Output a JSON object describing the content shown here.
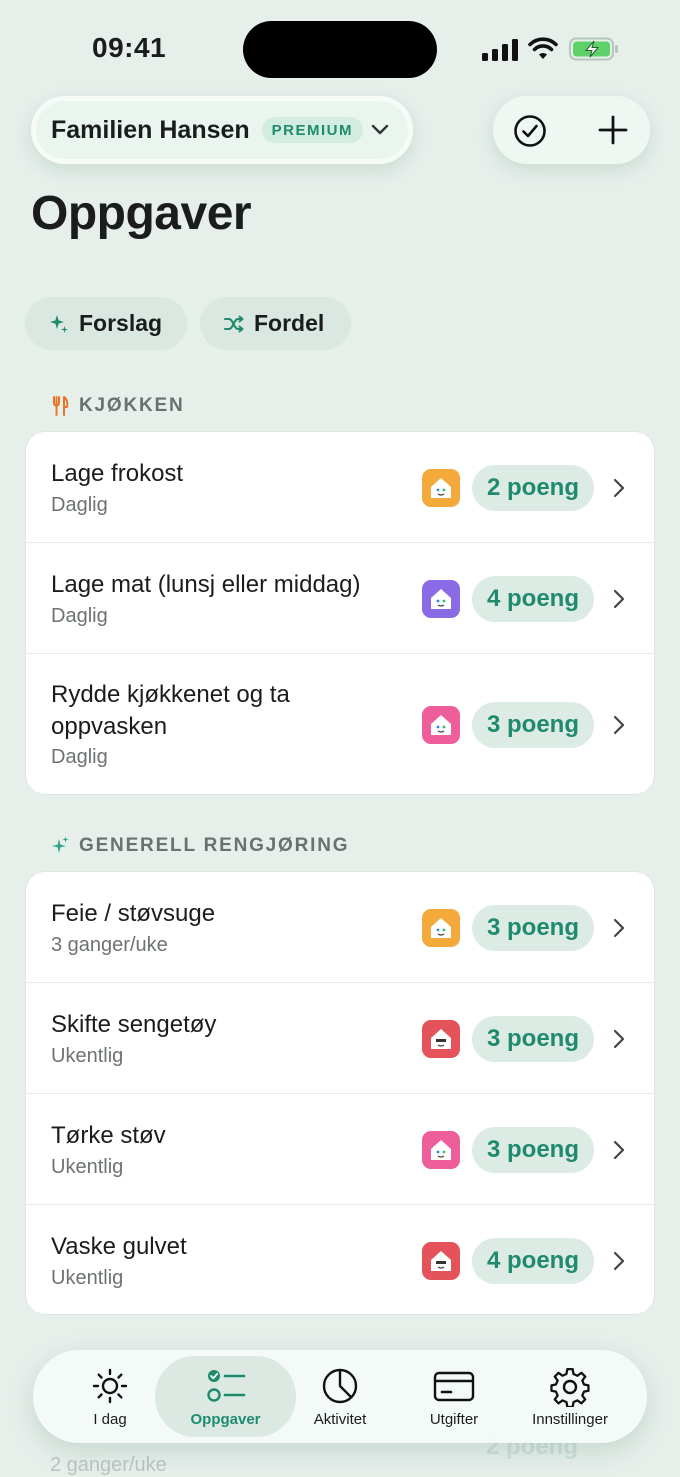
{
  "status_bar": {
    "time": "09:41"
  },
  "header": {
    "family_name": "Familien Hansen",
    "premium_label": "PREMIUM",
    "page_title": "Oppgaver"
  },
  "chips": {
    "forslag": "Forslag",
    "fordel": "Fordel"
  },
  "sections": [
    {
      "title": "KJØKKEN",
      "icon": "fork-knife-icon",
      "tasks": [
        {
          "title": "Lage frokost",
          "frequency": "Daglig",
          "points": "2 poeng",
          "avatar_color": "#f4a93b"
        },
        {
          "title": "Lage mat (lunsj eller middag)",
          "frequency": "Daglig",
          "points": "4 poeng",
          "avatar_color": "#8a6be6"
        },
        {
          "title": "Rydde kjøkkenet og ta oppvasken",
          "frequency": "Daglig",
          "points": "3 poeng",
          "avatar_color": "#ee5e9b"
        }
      ]
    },
    {
      "title": "GENERELL RENGJØRING",
      "icon": "sparkle-icon",
      "tasks": [
        {
          "title": "Feie / støvsuge",
          "frequency": "3 ganger/uke",
          "points": "3 poeng",
          "avatar_color": "#f4a93b"
        },
        {
          "title": "Skifte sengetøy",
          "frequency": "Ukentlig",
          "points": "3 poeng",
          "avatar_color": "#e4525a"
        },
        {
          "title": "Tørke støv",
          "frequency": "Ukentlig",
          "points": "3 poeng",
          "avatar_color": "#ee5e9b"
        },
        {
          "title": "Vaske gulvet",
          "frequency": "Ukentlig",
          "points": "4 poeng",
          "avatar_color": "#e4525a"
        }
      ]
    }
  ],
  "partial_row": {
    "frequency": "2 ganger/uke",
    "points": "2 poeng"
  },
  "tab_bar": {
    "items": [
      {
        "label": "I dag",
        "icon": "sun-icon"
      },
      {
        "label": "Oppgaver",
        "icon": "task-list-icon",
        "active": true
      },
      {
        "label": "Aktivitet",
        "icon": "pie-chart-icon"
      },
      {
        "label": "Utgifter",
        "icon": "credit-card-icon"
      },
      {
        "label": "Innstillinger",
        "icon": "gear-icon"
      }
    ]
  },
  "colors": {
    "accent": "#1f8a6d",
    "background": "#e7efeb",
    "points_bg": "#dcebe4"
  }
}
